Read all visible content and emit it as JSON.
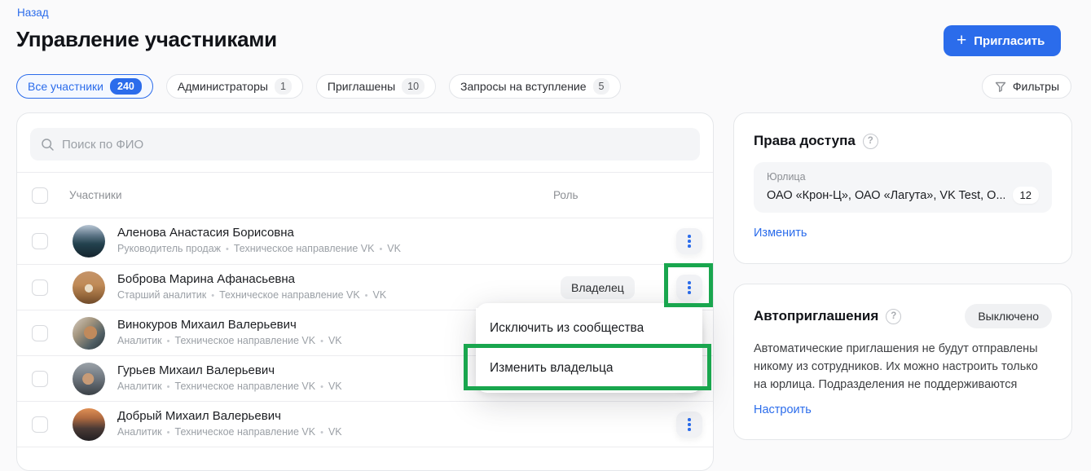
{
  "header": {
    "back_label": "Назад",
    "title": "Управление участниками",
    "invite_label": "Пригласить",
    "filters_label": "Фильтры"
  },
  "tabs": [
    {
      "label": "Все участники",
      "count": "240",
      "active": true
    },
    {
      "label": "Администраторы",
      "count": "1",
      "active": false
    },
    {
      "label": "Приглашены",
      "count": "10",
      "active": false
    },
    {
      "label": "Запросы на вступление",
      "count": "5",
      "active": false
    }
  ],
  "members_panel": {
    "search_placeholder": "Поиск по ФИО",
    "columns": {
      "members": "Участники",
      "role": "Роль"
    },
    "rows": [
      {
        "name": "Аленова Анастасия Борисовна",
        "meta": [
          "Руководитель продаж",
          "Техническое направление VK",
          "VK"
        ],
        "role": ""
      },
      {
        "name": "Боброва Марина Афанасьевна",
        "meta": [
          "Старший аналитик",
          "Техническое направление VK",
          "VK"
        ],
        "role": "Владелец"
      },
      {
        "name": "Винокуров Михаил Валерьевич",
        "meta": [
          "Аналитик",
          "Техническое направление VK",
          "VK"
        ],
        "role": ""
      },
      {
        "name": "Гурьев Михаил Валерьевич",
        "meta": [
          "Аналитик",
          "Техническое направление VK",
          "VK"
        ],
        "role": ""
      },
      {
        "name": "Добрый Михаил Валерьевич",
        "meta": [
          "Аналитик",
          "Техническое направление VK",
          "VK"
        ],
        "role": ""
      }
    ]
  },
  "context_menu": {
    "items": [
      "Исключить из сообщества",
      "Изменить владельца"
    ]
  },
  "access_rights_card": {
    "title": "Права доступа",
    "field_label": "Юрлица",
    "field_value": "ОАО «Крон-Ц», ОАО «Лагута», VK Test, О...",
    "field_count": "12",
    "action_label": "Изменить"
  },
  "auto_invites_card": {
    "title": "Автоприглашения",
    "status": "Выключено",
    "description": "Автоматические приглашения не будут отправлены никому из сотрудников. Их можно настроить только на юрлица. Подразделения не поддерживаются",
    "action_label": "Настроить"
  },
  "colors": {
    "accent": "#2b6ceb",
    "annotation_green": "#19a64e"
  }
}
